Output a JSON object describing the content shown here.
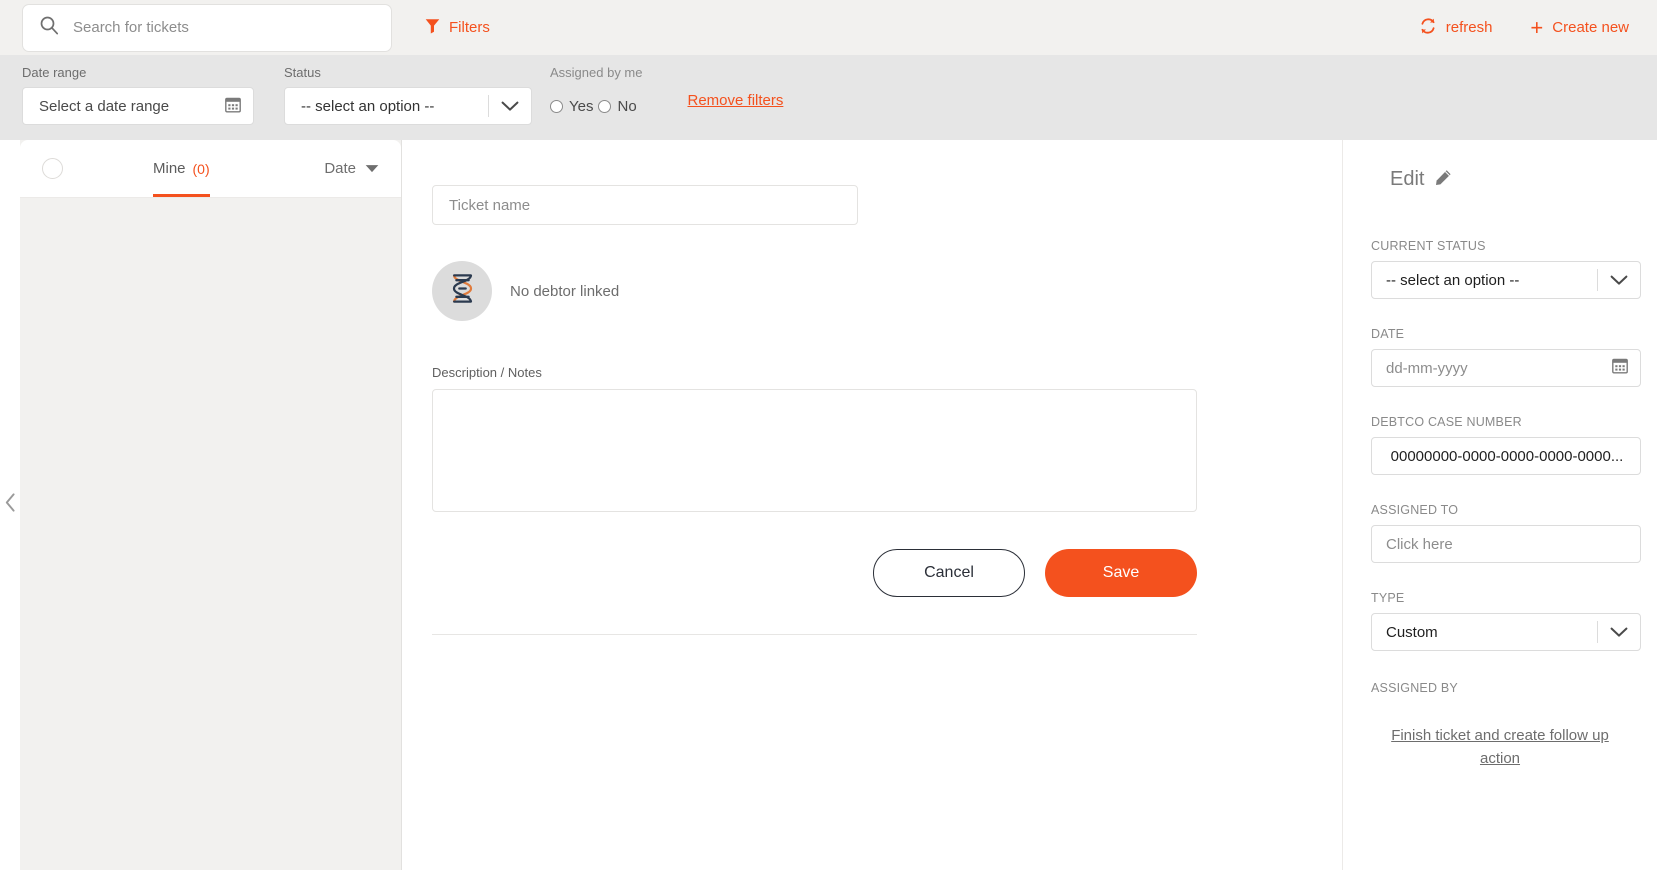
{
  "brand": {
    "accent": "#f4511e",
    "topbar_bg": "#f2f1ef",
    "filterbar_bg": "#e6e6e6",
    "list_bg": "#f2f1ef"
  },
  "topbar": {
    "search_placeholder": "Search for tickets",
    "search_value": "",
    "filters_label": "Filters",
    "refresh_label": "refresh",
    "create_new_label": "Create new"
  },
  "filterbar": {
    "date_range_label": "Date range",
    "date_range_value": "Select a date range",
    "status_label": "Status",
    "status_value": "-- select an option --",
    "assigned_by_me_label": "Assigned by me",
    "yes_label": "Yes",
    "no_label": "No",
    "remove_filters_label": "Remove filters"
  },
  "list_panel": {
    "tab_label": "Mine",
    "tab_count": "(0)",
    "sort_label": "Date"
  },
  "form": {
    "ticket_name_placeholder": "Ticket name",
    "ticket_name_value": "",
    "debtor_text": "No debtor linked",
    "description_label": "Description / Notes",
    "description_value": "",
    "cancel_label": "Cancel",
    "save_label": "Save"
  },
  "sidebar": {
    "edit_label": "Edit",
    "current_status_label": "CURRENT STATUS",
    "current_status_value": "-- select an option --",
    "date_label": "DATE",
    "date_placeholder": "dd-mm-yyyy",
    "case_number_label": "DEBTCO CASE NUMBER",
    "case_number_value": "00000000-0000-0000-0000-0000...",
    "assigned_to_label": "ASSIGNED TO",
    "assigned_to_value": "Click here",
    "type_label": "TYPE",
    "type_value": "Custom",
    "assigned_by_label": "ASSIGNED BY",
    "finish_link_label": "Finish ticket and create follow up action"
  }
}
